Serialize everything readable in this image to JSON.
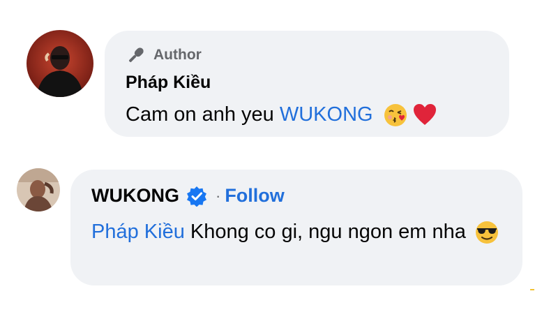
{
  "comments": [
    {
      "author_badge": "Author",
      "author_name": "Pháp Kiều",
      "text_prefix": "Cam on anh yeu ",
      "mention": "WUKONG",
      "emojis": [
        "kissing-heart-emoji",
        "red-heart-emoji"
      ]
    },
    {
      "author_name": "WUKONG",
      "verified": true,
      "separator": "·",
      "follow_label": "Follow",
      "mention": "Pháp Kiều",
      "text": " Khong co gi, ngu ngon em nha",
      "emojis": [
        "sunglasses-emoji"
      ]
    }
  ],
  "colors": {
    "bubble_bg": "#f0f2f5",
    "link_blue": "#216fdb",
    "muted_text": "#65676b",
    "verified_blue": "#1877f2"
  }
}
